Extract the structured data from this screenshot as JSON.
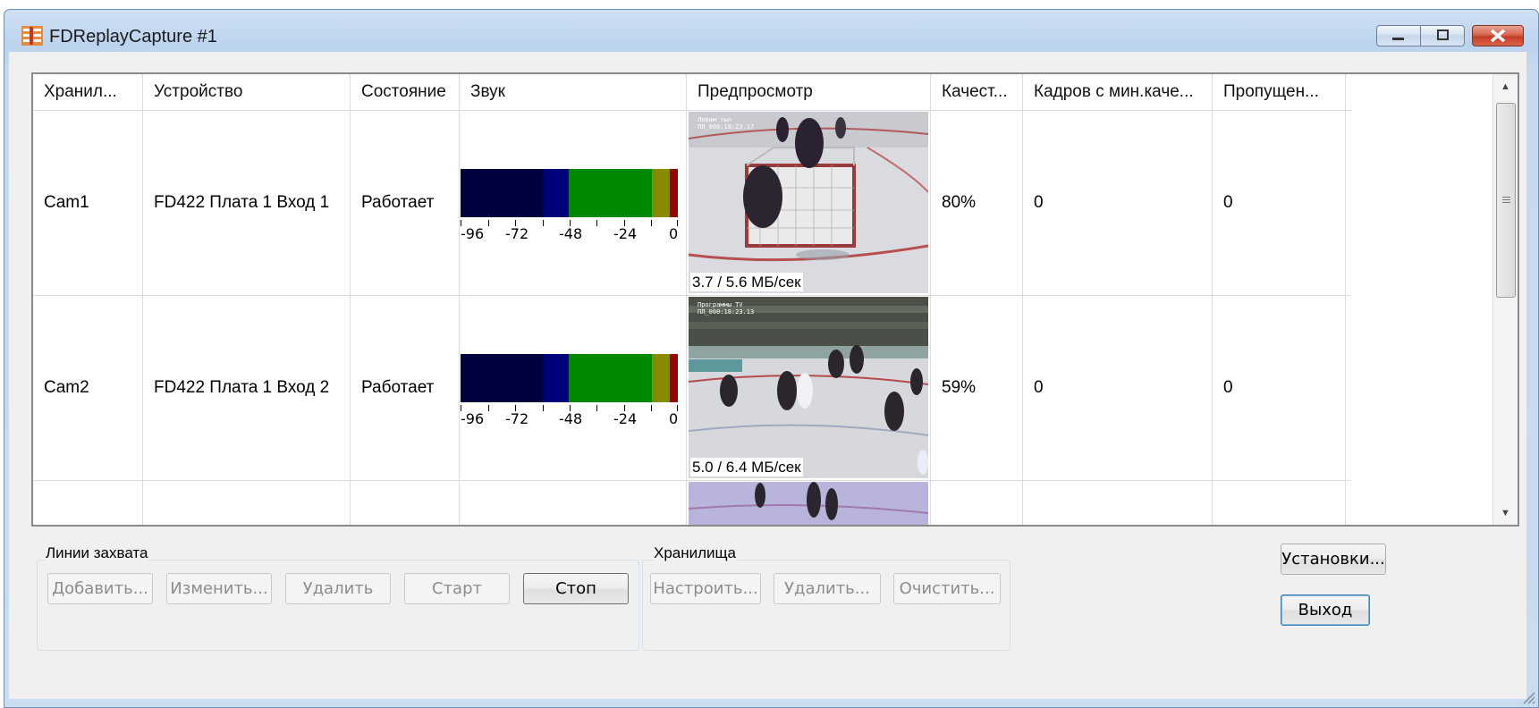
{
  "window": {
    "title": "FDReplayCapture #1"
  },
  "columns": [
    "Хранил...",
    "Устройство",
    "Состояние",
    "Звук",
    "Предпросмотр",
    "Качест...",
    "Кадров с мин.каче...",
    "Пропущен..."
  ],
  "rows": [
    {
      "storage": "Cam1",
      "device": "FD422 Плата 1 Вход 1",
      "state": "Работает",
      "quality": "80%",
      "min_frames": "0",
      "dropped": "0",
      "rate": "3.7 / 5.6 МБ/сек",
      "osd1": "Ловим тыл",
      "osd2": "ПЛ_000:18:23.17"
    },
    {
      "storage": "Cam2",
      "device": "FD422 Плата 1 Вход 2",
      "state": "Работает",
      "quality": "59%",
      "min_frames": "0",
      "dropped": "0",
      "rate": "5.0 / 6.4 МБ/сек",
      "osd1": "Программы TV",
      "osd2": "ПЛ_000:18:23.13"
    }
  ],
  "vu_scale": [
    "-96",
    "-72",
    "-48",
    "-24",
    "0"
  ],
  "vu_colors": {
    "navy_dark": "#00003f",
    "navy": "#00007a",
    "green": "#008800",
    "olive": "#8a8a00",
    "red": "#990000"
  },
  "capture_group": {
    "label": "Линии захвата",
    "buttons": {
      "add": "Добавить...",
      "edit": "Изменить...",
      "delete": "Удалить",
      "start": "Старт",
      "stop": "Стоп"
    }
  },
  "storage_group": {
    "label": "Хранилища",
    "buttons": {
      "configure": "Настроить...",
      "delete": "Удалить...",
      "clear": "Очистить..."
    }
  },
  "settings_button": "Установки...",
  "exit_button": "Выход",
  "icons": [
    "app-icon",
    "minimize-icon",
    "maximize-icon",
    "close-icon",
    "scroll-up-arrow-icon",
    "scroll-down-arrow-icon",
    "resize-grip-icon"
  ]
}
